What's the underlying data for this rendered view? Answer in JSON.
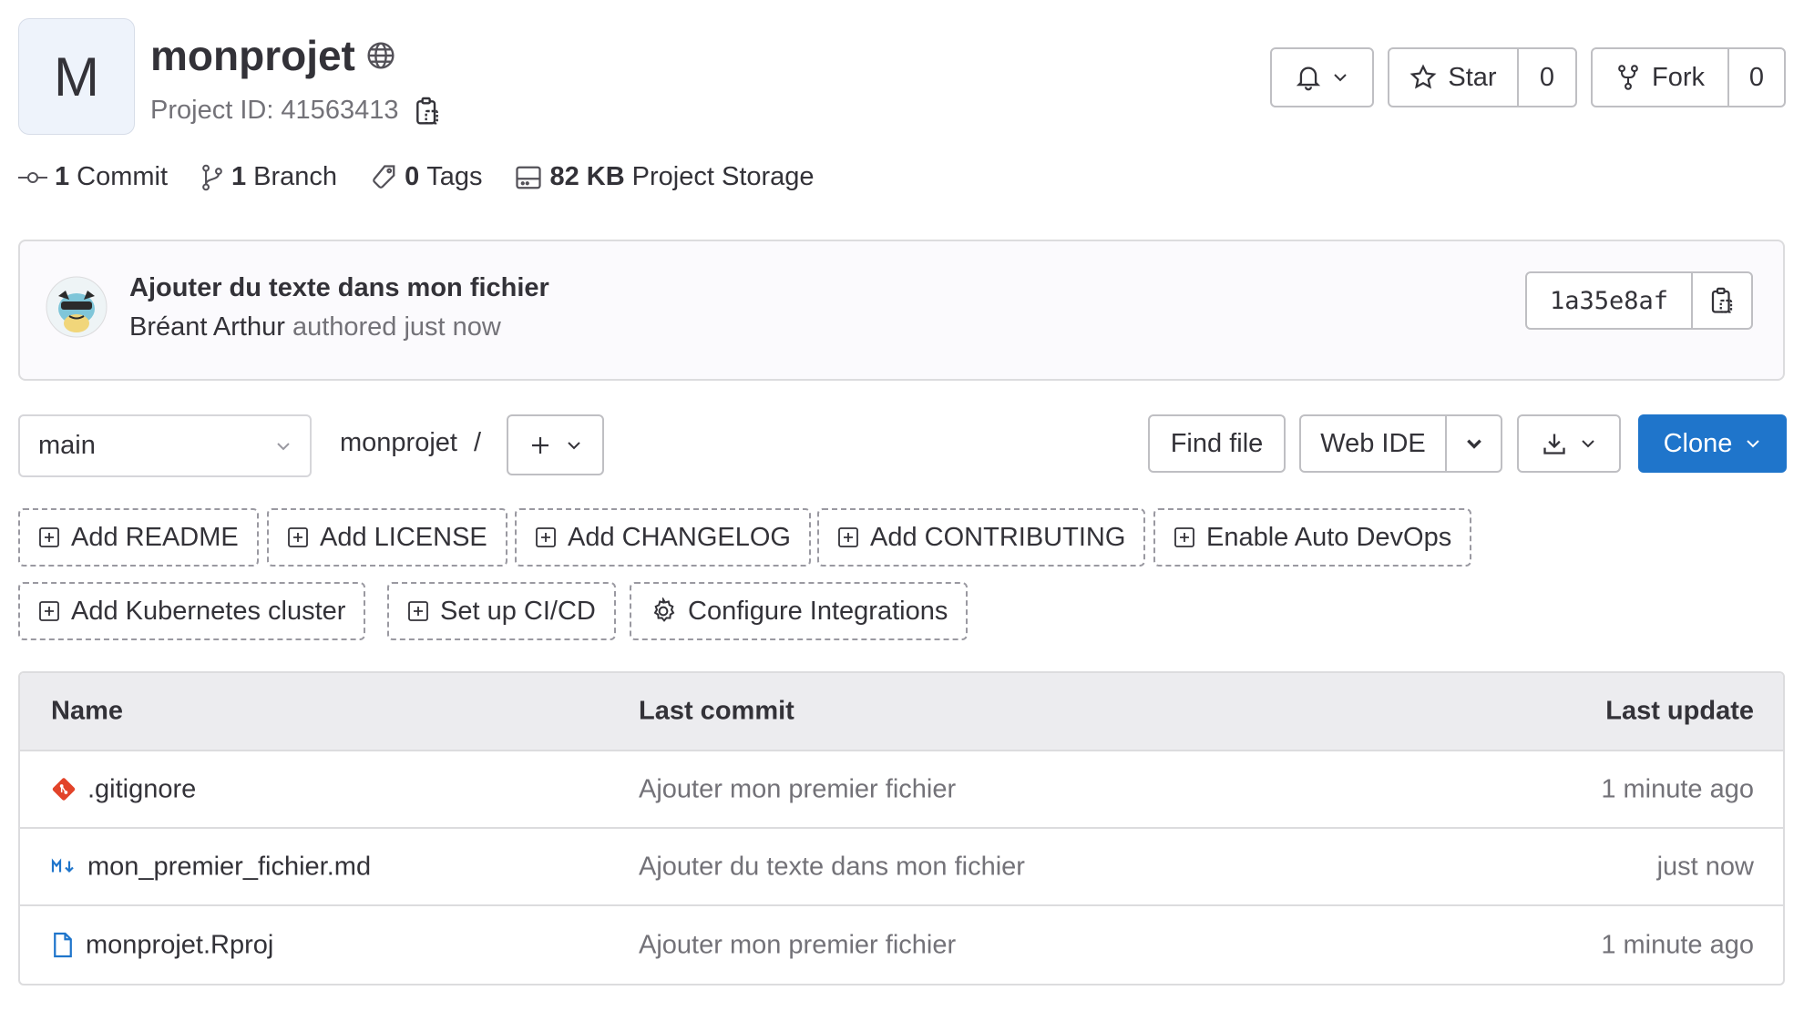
{
  "project": {
    "avatar_letter": "M",
    "name": "monprojet",
    "id_label": "Project ID: 41563413"
  },
  "actions": {
    "star_label": "Star",
    "star_count": "0",
    "fork_label": "Fork",
    "fork_count": "0"
  },
  "stats": [
    {
      "count": "1",
      "label": "Commit"
    },
    {
      "count": "1",
      "label": "Branch"
    },
    {
      "count": "0",
      "label": "Tags"
    },
    {
      "count": "82 KB",
      "label": "Project Storage"
    }
  ],
  "last_commit": {
    "title": "Ajouter du texte dans mon fichier",
    "author": "Bréant Arthur",
    "meta": "authored just now",
    "sha": "1a35e8af"
  },
  "toolbar": {
    "branch": "main",
    "path": "monprojet",
    "separator": "/",
    "find_file": "Find file",
    "web_ide": "Web IDE",
    "clone": "Clone"
  },
  "quick_actions": [
    "Add README",
    "Add LICENSE",
    "Add CHANGELOG",
    "Add CONTRIBUTING",
    "Enable Auto DevOps",
    "Add Kubernetes cluster",
    "Set up CI/CD",
    "Configure Integrations"
  ],
  "table": {
    "headers": {
      "name": "Name",
      "commit": "Last commit",
      "update": "Last update"
    },
    "rows": [
      {
        "name": ".gitignore",
        "icon": "git-file-icon",
        "commit": "Ajouter mon premier fichier",
        "update": "1 minute ago"
      },
      {
        "name": "mon_premier_fichier.md",
        "icon": "markdown-file-icon",
        "commit": "Ajouter du texte dans mon fichier",
        "update": "just now"
      },
      {
        "name": "monprojet.Rproj",
        "icon": "file-icon",
        "commit": "Ajouter mon premier fichier",
        "update": "1 minute ago"
      }
    ]
  },
  "colors": {
    "primary": "#1f75cb",
    "git_icon": "#e24329",
    "markdown_icon": "#1f75cb"
  }
}
